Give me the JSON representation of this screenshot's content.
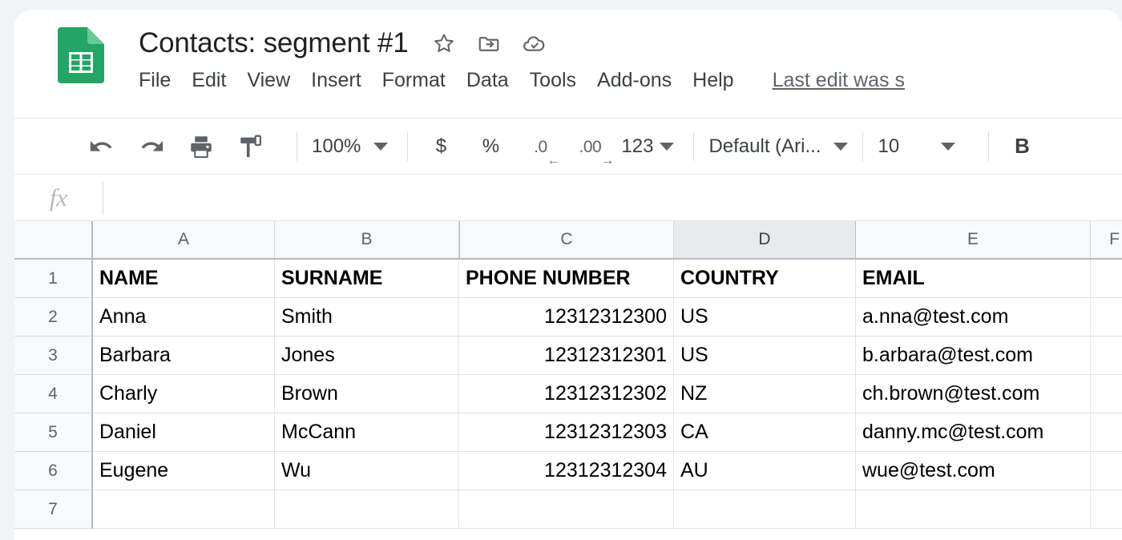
{
  "app": {
    "logo_icon": "google-sheets-logo",
    "logo_color": "#23a566",
    "title": "Contacts: segment #1"
  },
  "title_icons": [
    {
      "name": "star-icon",
      "label": "Star"
    },
    {
      "name": "move-to-folder-icon",
      "label": "Move to folder"
    },
    {
      "name": "cloud-saved-icon",
      "label": "Saved to Drive"
    }
  ],
  "menu": {
    "items": [
      "File",
      "Edit",
      "View",
      "Insert",
      "Format",
      "Data",
      "Tools",
      "Add-ons",
      "Help"
    ],
    "last_edit": "Last edit was s"
  },
  "toolbar": {
    "undo_icon": "undo-icon",
    "redo_icon": "redo-icon",
    "print_icon": "print-icon",
    "paint_format_icon": "paint-format-icon",
    "zoom_value": "100%",
    "currency_label": "$",
    "percent_label": "%",
    "decrease_decimal_label": ".0",
    "increase_decimal_label": ".00",
    "number_format_label": "123",
    "font_family_value": "Default (Ari...",
    "font_size_value": "10",
    "bold_label": "B"
  },
  "formula_bar": {
    "fx_label": "fx",
    "value": "",
    "placeholder": ""
  },
  "grid": {
    "columns": [
      "A",
      "B",
      "C",
      "D",
      "E",
      "F"
    ],
    "selected_column": "D",
    "row_numbers": [
      "1",
      "2",
      "3",
      "4",
      "5",
      "6",
      "7"
    ],
    "rows": [
      {
        "A": "NAME",
        "B": "SURNAME",
        "C": "PHONE NUMBER",
        "D": "COUNTRY",
        "E": "EMAIL",
        "F": "",
        "bold": true,
        "numeric_c": false
      },
      {
        "A": "Anna",
        "B": "Smith",
        "C": "12312312300",
        "D": "US",
        "E": "a.nna@test.com",
        "F": "",
        "bold": false,
        "numeric_c": true
      },
      {
        "A": "Barbara",
        "B": "Jones",
        "C": "12312312301",
        "D": "US",
        "E": "b.arbara@test.com",
        "F": "",
        "bold": false,
        "numeric_c": true
      },
      {
        "A": "Charly",
        "B": "Brown",
        "C": "12312312302",
        "D": "NZ",
        "E": "ch.brown@test.com",
        "F": "",
        "bold": false,
        "numeric_c": true
      },
      {
        "A": "Daniel",
        "B": "McCann",
        "C": "12312312303",
        "D": "CA",
        "E": "danny.mc@test.com",
        "F": "",
        "bold": false,
        "numeric_c": true
      },
      {
        "A": "Eugene",
        "B": "Wu",
        "C": "12312312304",
        "D": "AU",
        "E": "wue@test.com",
        "F": "",
        "bold": false,
        "numeric_c": true
      },
      {
        "A": "",
        "B": "",
        "C": "",
        "D": "",
        "E": "",
        "F": "",
        "bold": false,
        "numeric_c": false
      }
    ]
  },
  "colors": {
    "brand_green": "#23a566",
    "text_primary": "#202124",
    "text_secondary": "#5f6368",
    "grid_line": "#e0e2e4",
    "header_bg": "#f8f9fa",
    "selected_col_bg": "#e8eaed",
    "page_bg": "#f1f3f5"
  }
}
